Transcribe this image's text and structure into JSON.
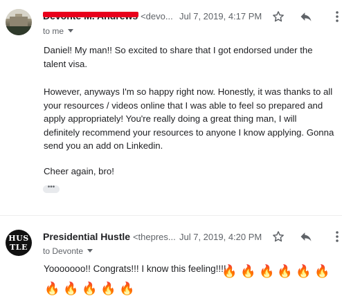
{
  "messages": [
    {
      "sender_name": "Devonte M. Andrews",
      "sender_email_short": "<devo...",
      "date": "Jul 7, 2019, 4:17 PM",
      "recipient": "to me",
      "paragraphs": [
        "Daniel! My man!! So excited to share that I got endorsed under the talent visa.",
        "However, anyways I'm so happy right now. Honestly, it was thanks to all your resources / videos online that I was able to feel so prepared and apply appropriately! You're really doing a great thing man, I will definitely recommend your resources to anyone I know applying. Gonna send you an add on Linkedin.",
        "Cheer again, bro!"
      ],
      "trimmed_label": "•••"
    },
    {
      "sender_name": "Presidential Hustle",
      "sender_email_short": "<thepres...",
      "date": "Jul 7, 2019, 4:20 PM",
      "recipient": "to Devonte",
      "avatar_line1": "HUS",
      "avatar_line2": "TLE",
      "body": "Yooooooo!!  Congrats!!! I know this feeling!!!!",
      "fire_emoji": "🔥"
    }
  ],
  "icons": {
    "star": "star-icon",
    "reply": "reply-icon",
    "more": "more-vert-icon"
  },
  "colors": {
    "redaction": "#e8001c",
    "secondary_text": "#5f6368"
  }
}
